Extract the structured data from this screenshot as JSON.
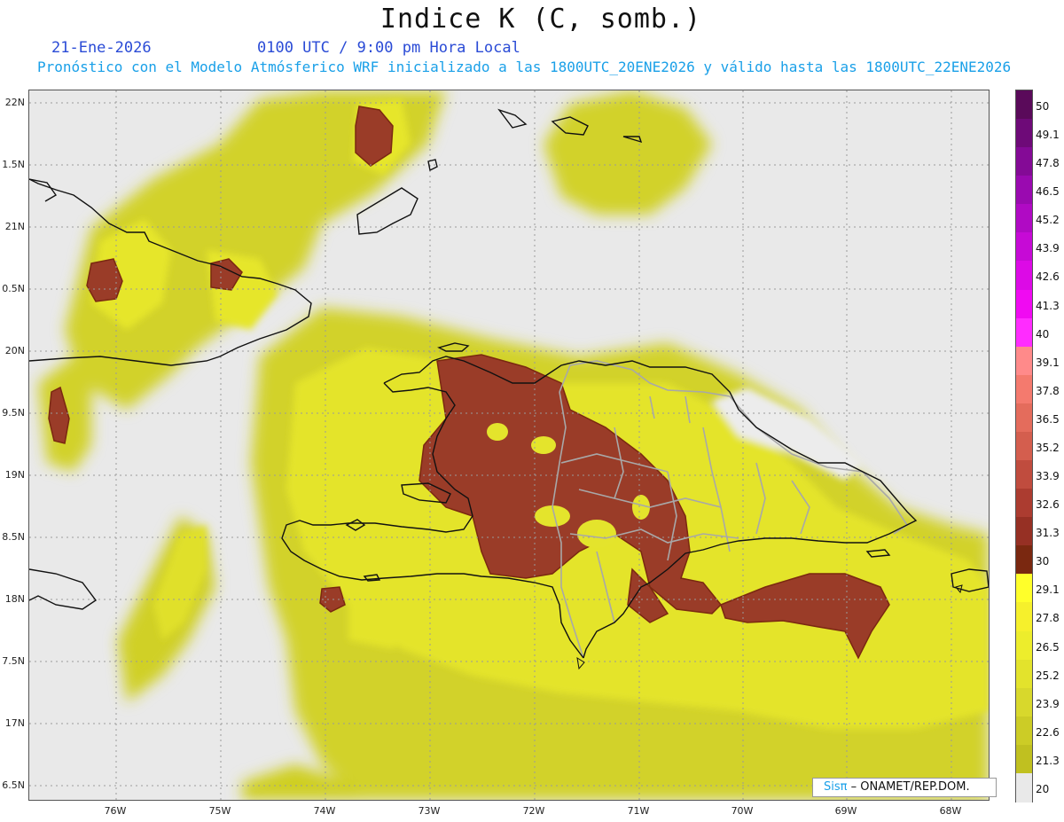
{
  "title": "Indice K (C, somb.)",
  "date": "21-Ene-2026",
  "time": "0100 UTC / 9:00 pm Hora Local",
  "subtitle": "Pronóstico con el Modelo Atmósferico WRF inicializado a las 1800UTC_20ENE2026 y válido hasta las  1800UTC_22ENE2026",
  "credit": {
    "logo": "Sisπ",
    "org": "– ONAMET/REP.DOM."
  },
  "map": {
    "lat_labels": [
      "22N",
      "1.5N",
      "21N",
      "0.5N",
      "20N",
      "9.5N",
      "19N",
      "8.5N",
      "18N",
      "7.5N",
      "17N",
      "6.5N"
    ],
    "lon_labels": [
      "76W",
      "75W",
      "74W",
      "73W",
      "72W",
      "71W",
      "70W",
      "69W",
      "68W"
    ],
    "colors": {
      "land_border": "#111111",
      "province_border": "#a8a8a8",
      "grid": "#9a9a9a",
      "background": "#e9e9e9"
    }
  },
  "colorbar": {
    "labels": [
      "50",
      "49.1",
      "47.8",
      "46.5",
      "45.2",
      "43.9",
      "42.6",
      "41.3",
      "40",
      "39.1",
      "37.8",
      "36.5",
      "35.2",
      "33.9",
      "32.6",
      "31.3",
      "30",
      "29.1",
      "27.8",
      "26.5",
      "25.2",
      "23.9",
      "22.6",
      "21.3",
      "20"
    ],
    "colors": [
      "#5a0a5a",
      "#6e0a78",
      "#840a96",
      "#9a0ab0",
      "#b00ac4",
      "#c60ad6",
      "#dc0ae6",
      "#f00af2",
      "#ff2cff",
      "#ff8a8a",
      "#f47a6e",
      "#e46c5c",
      "#d45e4e",
      "#c04c3e",
      "#ac3c30",
      "#963024",
      "#7a2810",
      "#ffff2a",
      "#f6f02c",
      "#eded2c",
      "#e3e32c",
      "#d8d82c",
      "#cccc26",
      "#c0c020",
      "#e9e9e9"
    ]
  }
}
